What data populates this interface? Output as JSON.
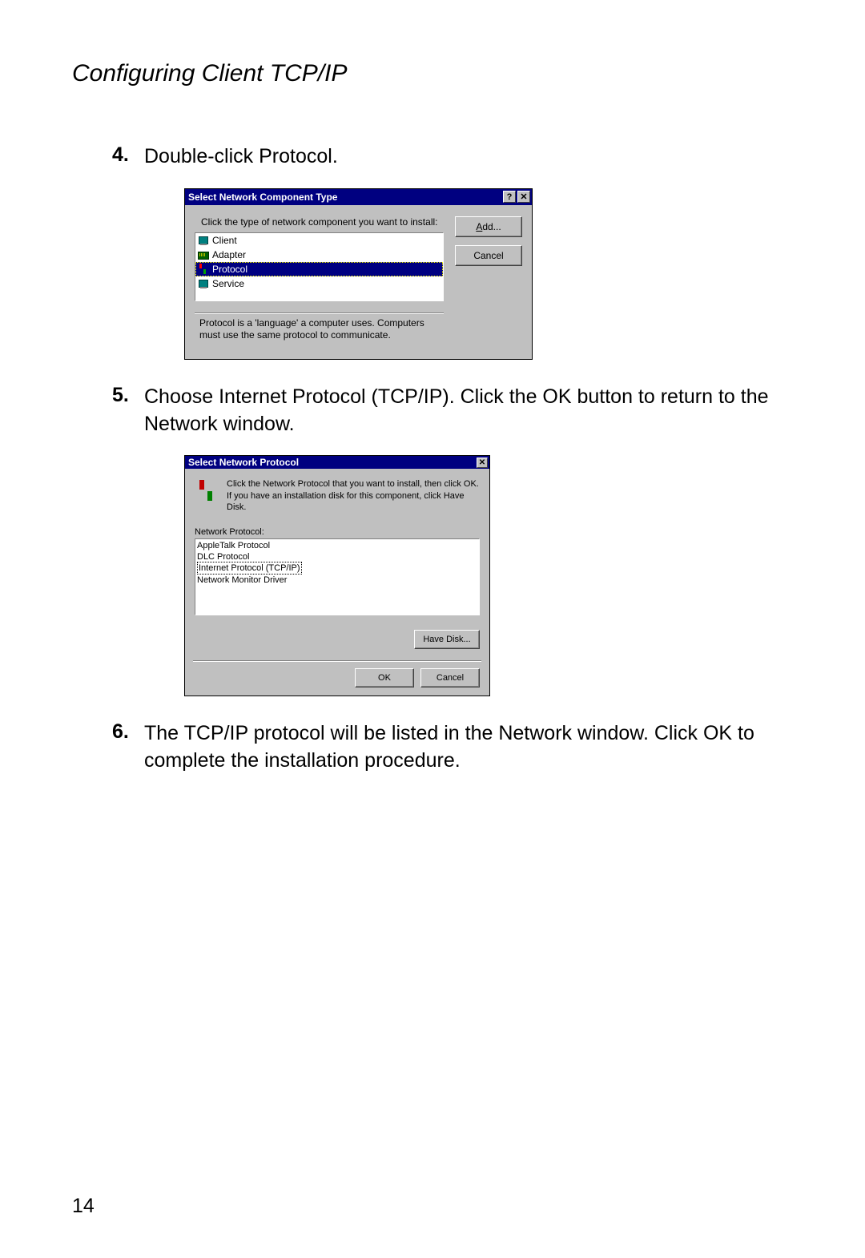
{
  "section_title": "Configuring Client TCP/IP",
  "steps": [
    {
      "num": "4.",
      "text": "Double-click Protocol."
    },
    {
      "num": "5.",
      "text": "Choose Internet Protocol (TCP/IP). Click the OK button to return to the Network window."
    },
    {
      "num": "6.",
      "text": "The TCP/IP protocol will be listed in the Network window. Click OK to complete the installation procedure."
    }
  ],
  "page_number": "14",
  "dialog1": {
    "title": "Select Network Component Type",
    "help_glyph": "?",
    "close_glyph": "✕",
    "instruction": "Click the type of network component you want to install:",
    "items": {
      "client": "Client",
      "adapter": "Adapter",
      "protocol": "Protocol",
      "service": "Service"
    },
    "add_prefix": "A",
    "add_suffix": "dd...",
    "cancel_label": "Cancel",
    "description": "Protocol is a 'language' a computer uses. Computers must use the same protocol to communicate."
  },
  "dialog2": {
    "title": "Select Network Protocol",
    "close_glyph": "✕",
    "message": "Click the Network Protocol that you want to install, then click OK. If you have an installation disk for this component, click Have Disk.",
    "list_label": "Network Protocol:",
    "protocols": {
      "appletalk": "AppleTalk Protocol",
      "dlc": "DLC Protocol",
      "tcpip": "Internet Protocol (TCP/IP)",
      "monitor": "Network Monitor Driver"
    },
    "have_disk_label": "Have Disk...",
    "ok_label": "OK",
    "cancel_label": "Cancel"
  }
}
